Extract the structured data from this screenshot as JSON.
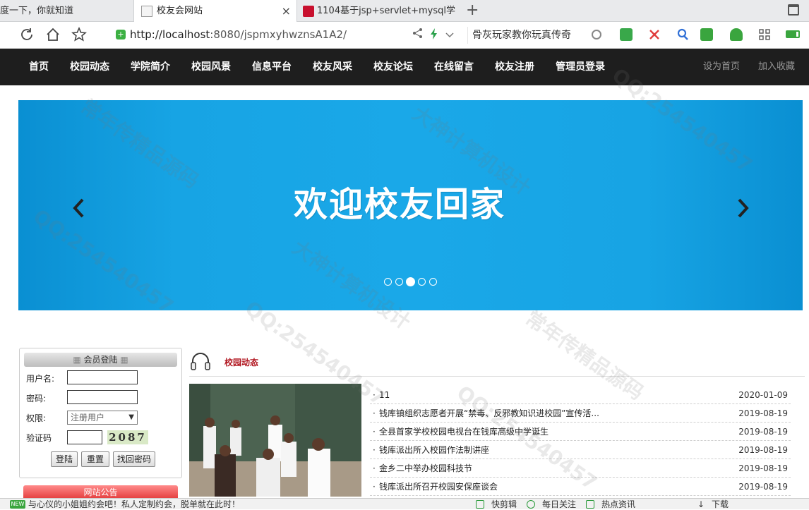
{
  "browser": {
    "tabs": [
      {
        "label": "度一下，你就知道",
        "active": false
      },
      {
        "label": "校友会网站",
        "active": true,
        "close": "×"
      },
      {
        "label": "1104基于jsp+servlet+mysql学",
        "active": false
      }
    ],
    "new_tab": "+",
    "url": {
      "host": "http://localhost",
      "rest": ":8080/jspmxyhwznsA1A2/"
    },
    "search_text": "骨灰玩家教你玩真传奇"
  },
  "site_nav": {
    "items": [
      "首页",
      "校园动态",
      "学院简介",
      "校园风景",
      "信息平台",
      "校友风采",
      "校友论坛",
      "在线留言",
      "校友注册",
      "管理员登录"
    ],
    "right_links": [
      "设为首页",
      "加入收藏"
    ]
  },
  "banner": {
    "title": "欢迎校友回家",
    "dots": 5,
    "active_dot": 2
  },
  "login": {
    "header": "会员登陆",
    "username_label": "用户名:",
    "password_label": "密码:",
    "role_label": "权限:",
    "role_value": "注册用户",
    "captcha_label": "验证码",
    "captcha_value": "2087",
    "buttons": {
      "login": "登陆",
      "reset": "重置",
      "recover": "找回密码"
    },
    "notice_header": "网站公告"
  },
  "news": {
    "title": "校园动态",
    "items": [
      {
        "title": "11",
        "date": "2020-01-09"
      },
      {
        "title": "钱库镇组织志愿者开展“禁毒、反邪教知识进校园”宣传活...",
        "date": "2019-08-19"
      },
      {
        "title": "全县首家学校校园电视台在钱库高级中学诞生",
        "date": "2019-08-19"
      },
      {
        "title": "钱库派出所入校园作法制讲座",
        "date": "2019-08-19"
      },
      {
        "title": "金乡二中举办校园科技节",
        "date": "2019-08-19"
      },
      {
        "title": "钱库派出所召开校园安保座谈会",
        "date": "2019-08-19"
      }
    ]
  },
  "statusbar": {
    "badge": "NEW",
    "ad_text": "与心仪的小姐姐约会吧！私人定制约会，脱单就在此时！",
    "items": [
      "快剪辑",
      "每日关注",
      "热点资讯",
      "下载"
    ]
  },
  "watermark": {
    "lines": [
      "常年传精品源码",
      "大神计算机设计",
      "QQ:254540457"
    ]
  },
  "colors": {
    "nav_bg": "#1e1e1e",
    "banner_blue": "#1aa8e8",
    "news_title": "#b0131d"
  }
}
